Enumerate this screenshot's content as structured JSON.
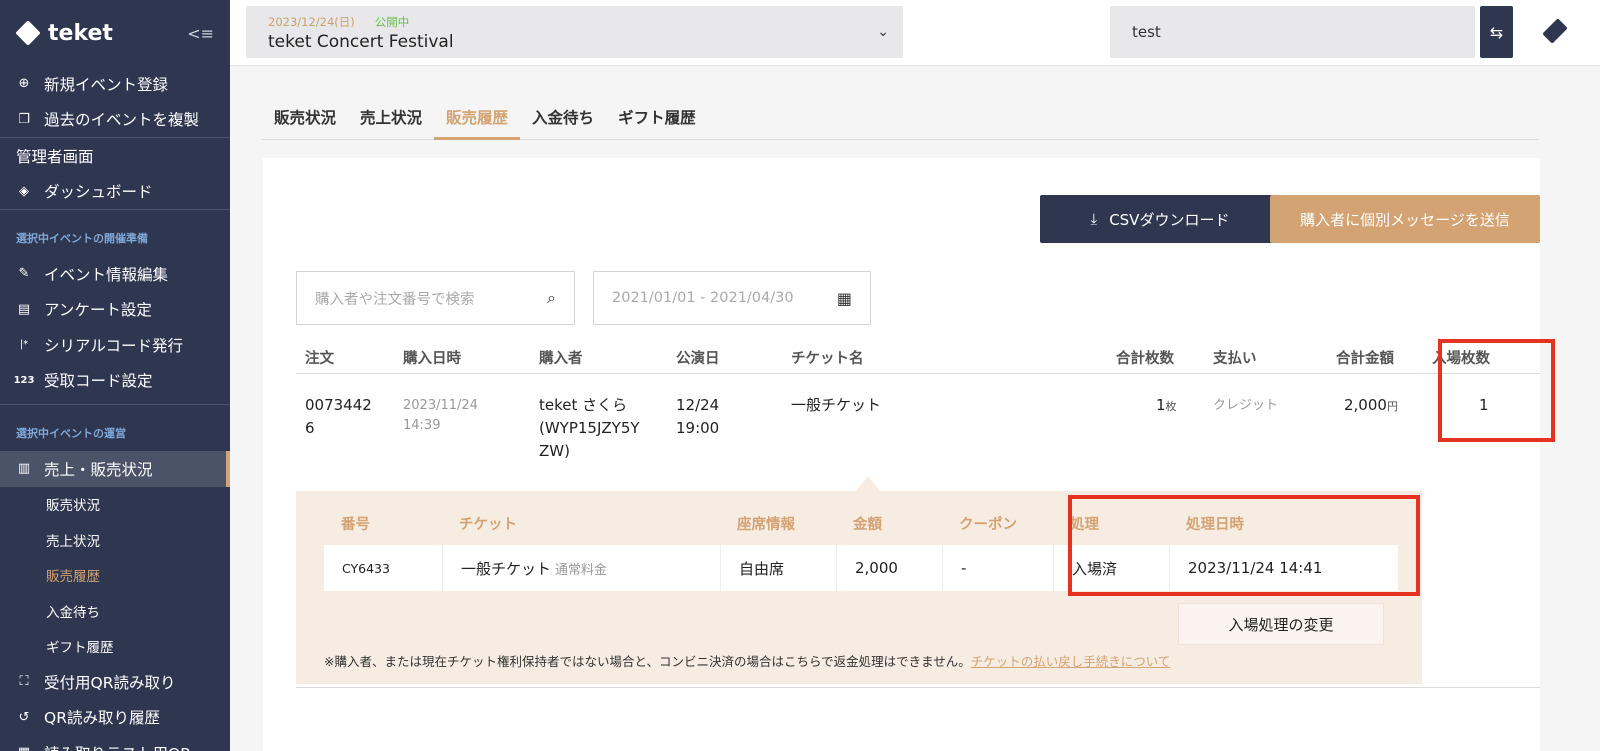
{
  "brand": {
    "name": "teket",
    "collapse_icon": "collapse-menu-icon"
  },
  "sidebar": {
    "top_items": [
      {
        "label": "新規イベント登録",
        "icon": "⊕",
        "icon_name": "plus-circle-icon"
      },
      {
        "label": "過去のイベントを複製",
        "icon": "❐",
        "icon_name": "copy-icon"
      }
    ],
    "admin_label": "管理者画面",
    "dashboard_label": "ダッシュボード",
    "section1": "選択中イベントの開催準備",
    "prep_items": [
      {
        "label": "イベント情報編集",
        "icon": "✎",
        "icon_name": "edit-icon"
      },
      {
        "label": "アンケート設定",
        "icon": "▤",
        "icon_name": "document-icon"
      },
      {
        "label": "シリアルコード発行",
        "icon": "|*",
        "icon_name": "serial-code-icon"
      },
      {
        "label": "受取コード設定",
        "icon": "123",
        "icon_name": "number-icon"
      }
    ],
    "section2": "選択中イベントの運営",
    "active_label": "売上・販売状況",
    "sub_items": [
      "販売状況",
      "売上状況",
      "販売履歴",
      "入金待ち",
      "ギフト履歴"
    ],
    "bottom_items": [
      {
        "label": "受付用QR読み取り",
        "icon": "⛶",
        "icon_name": "qr-scan-icon"
      },
      {
        "label": "QR読み取り履歴",
        "icon": "↺",
        "icon_name": "history-icon"
      },
      {
        "label": "読み取りテスト用QR",
        "icon": "▦",
        "icon_name": "qr-icon"
      }
    ]
  },
  "header": {
    "event_date": "2023/12/24(日)",
    "event_status": "公開中",
    "event_name": "teket Concert Festival",
    "user": "test"
  },
  "tabs": [
    {
      "label": "販売状況",
      "active": false
    },
    {
      "label": "売上状況",
      "active": false
    },
    {
      "label": "販売履歴",
      "active": true
    },
    {
      "label": "入金待ち",
      "active": false
    },
    {
      "label": "ギフト履歴",
      "active": false
    }
  ],
  "actions": {
    "csv_label": "CSVダウンロード",
    "message_label": "購入者に個別メッセージを送信"
  },
  "filters": {
    "search_placeholder": "購入者や注文番号で検索",
    "date_range": "2021/01/01 - 2021/04/30"
  },
  "orders": {
    "columns": [
      "注文",
      "購入日時",
      "購入者",
      "公演日",
      "チケット名",
      "合計枚数",
      "支払い",
      "合計金額",
      "入場枚数"
    ],
    "row": {
      "order_line1": "0073442",
      "order_line2": "6",
      "purchase_date": "2023/11/24",
      "purchase_time": "14:39",
      "buyer_line1": "teket さくら",
      "buyer_line2": "(WYP15JZY5Y",
      "buyer_line3": "ZW)",
      "show_date": "12/24",
      "show_time": "19:00",
      "ticket_name": "一般チケット",
      "quantity": "1",
      "quantity_unit": "枚",
      "payment": "クレジット",
      "amount": "2,000",
      "amount_unit": "円",
      "entered": "1"
    }
  },
  "detail": {
    "columns": [
      "番号",
      "チケット",
      "座席情報",
      "金額",
      "クーポン",
      "処理",
      "処理日時"
    ],
    "row": {
      "number": "CY6433",
      "ticket": "一般チケット",
      "ticket_type": "通常料金",
      "seat": "自由席",
      "price": "2,000",
      "coupon": "-",
      "status": "入場済",
      "processed_at": "2023/11/24 14:41"
    },
    "change_button": "入場処理の変更",
    "note": "※購入者、または現在チケット権利保持者ではない場合と、コンビニ決済の場合はこちらで返金処理はできません。",
    "note_link": "チケットの払い戻し手続きについて"
  },
  "colors": {
    "sidebar_bg": "#2e3650",
    "accent": "#d4a373",
    "highlight": "#e53221",
    "status_green": "#6cbf4d"
  }
}
